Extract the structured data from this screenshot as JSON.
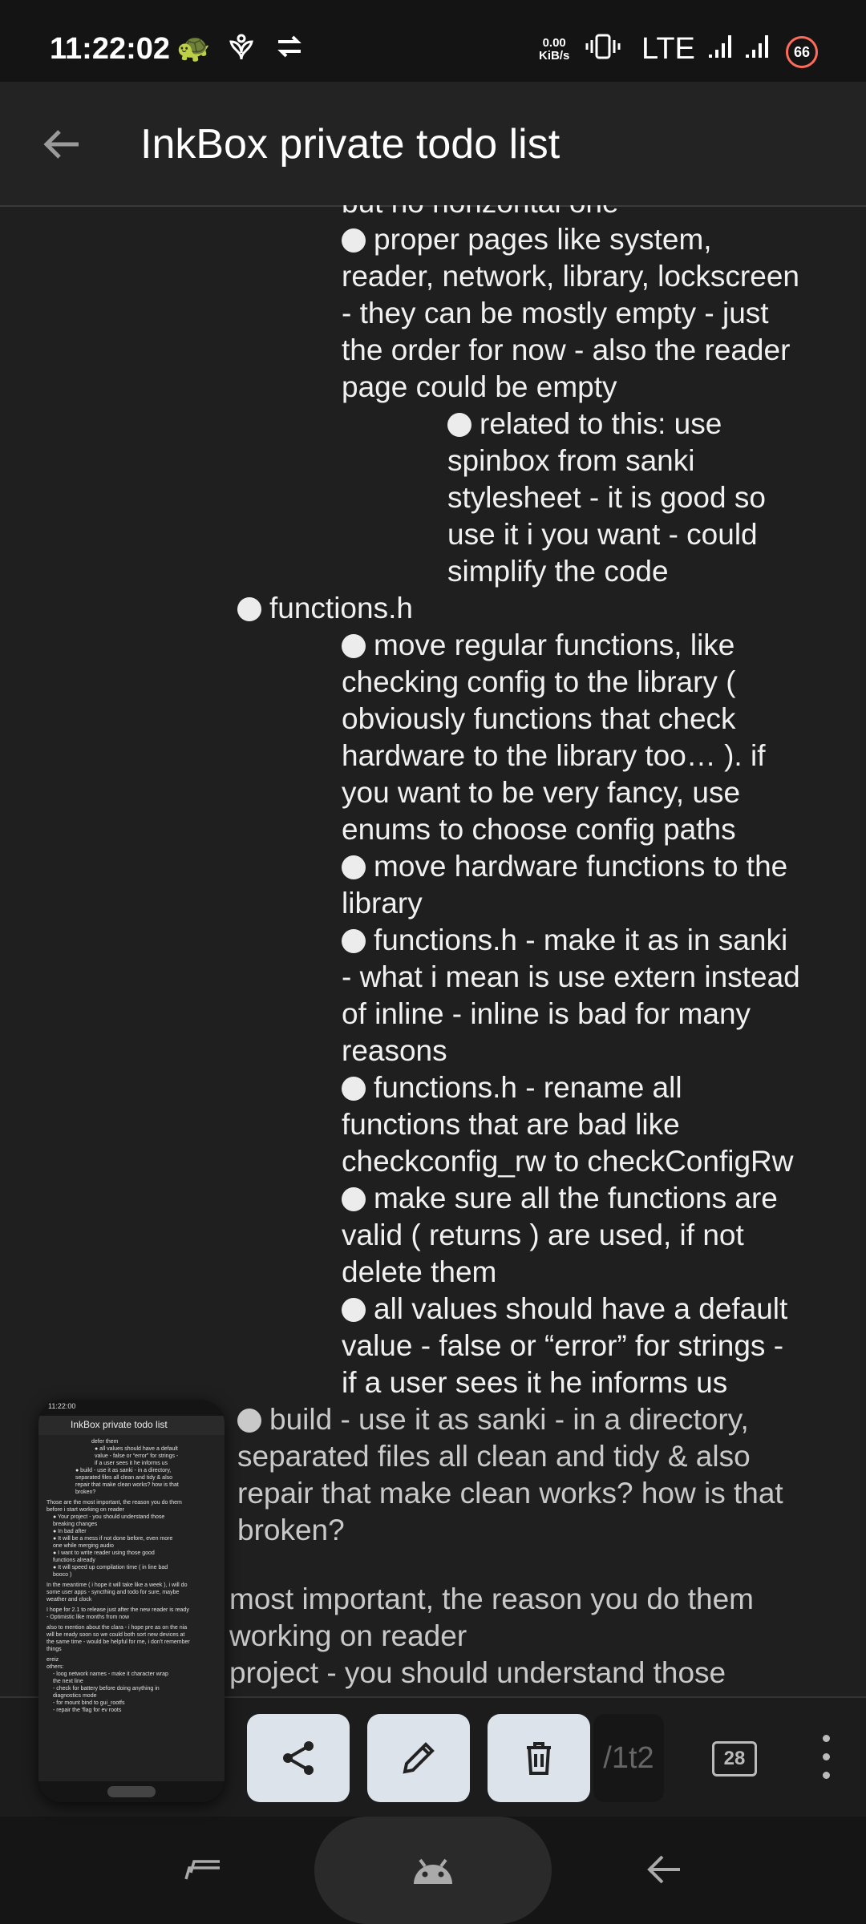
{
  "status_bar": {
    "time": "11:22:02",
    "net_speed_value": "0.00",
    "net_speed_unit": "KiB/s",
    "network": "LTE",
    "battery": "66",
    "icons": [
      "turtle-icon",
      "leaf-icon",
      "sync-arrows-icon",
      "vibrate-icon",
      "signal-icon",
      "signal-icon"
    ]
  },
  "app_bar": {
    "title": "InkBox private todo list"
  },
  "content": {
    "lines": [
      "but no horizontal one",
      "proper pages like system,",
      "reader, network, library, lockscreen",
      "- they can be mostly empty - just",
      "the order for now - also the reader",
      "page could be empty",
      "related to this: use",
      "spinbox from sanki",
      "stylesheet - it is good so",
      "use it i you want - could",
      "simplify the code",
      "functions.h",
      "move regular functions, like",
      "checking config to the library (",
      "obviously functions that check",
      "hardware to the library too… ). if",
      "you want to be very fancy, use",
      "enums to choose config paths",
      "move hardware functions to the",
      "library",
      "functions.h - make it as in sanki",
      "- what i mean is use extern instead",
      "of inline - inline is bad for many",
      "reasons",
      "functions.h - rename all",
      "functions that are bad like",
      "checkconfig_rw to checkConfigRw",
      "make sure all the functions are",
      "valid ( returns ) are used, if not",
      "delete them",
      "all values should have a default",
      "value - false or “error” for strings -",
      "if a user sees it he informs us",
      "build - use it as sanki - in a directory,",
      "separated files all clean and tidy & also",
      "repair that make clean works? how is that",
      "broken?",
      "most important, the reason you do them",
      "working on reader",
      "project - you should understand those"
    ]
  },
  "toolbar": {
    "page_indicator": "/1t2",
    "font_size": "28"
  },
  "preview": {
    "status": "11:22:00",
    "title": "InkBox private todo list",
    "lines": [
      "defer them",
      "● all values should have a default",
      "value - false or “error” for strings -",
      "if a user sees it he informs us",
      "● build - use it as sanki - in a directory,",
      "separated files all clean and tidy & also",
      "repair that make clean works? how is that",
      "broken?",
      "Those are the most important, the reason you do them",
      "before i start working on reader",
      "● Your project - you should understand those",
      "breaking changes",
      "● In bad after",
      "● It will be a mess if not done before, even more",
      "one while merging audio",
      "● I want to write reader using those good",
      "functions already",
      "● It will speed up compilation time ( in line bad",
      "booco )",
      "In the meantime ( i hope it will take like a week ), i will do",
      "some user apps - syncthing and todo for sure, maybe",
      "weather and clock",
      "I hope for 2.1 to release just after the new reader is ready",
      "- Optimistic like months from now",
      "also to mention about the clara - i hope pre as on the nia",
      "will be ready soon so we could both sort new devices at",
      "the same time - would be helpful for me, i don't remember",
      "things",
      "ereiz",
      "others:",
      "- loog network names - make it character wrap",
      "the next line",
      "- check for battery before doing anything in",
      "diagnostics mode",
      "- for mount bind to gui_rootfs",
      "- repair the 'flag for ev roots"
    ]
  }
}
